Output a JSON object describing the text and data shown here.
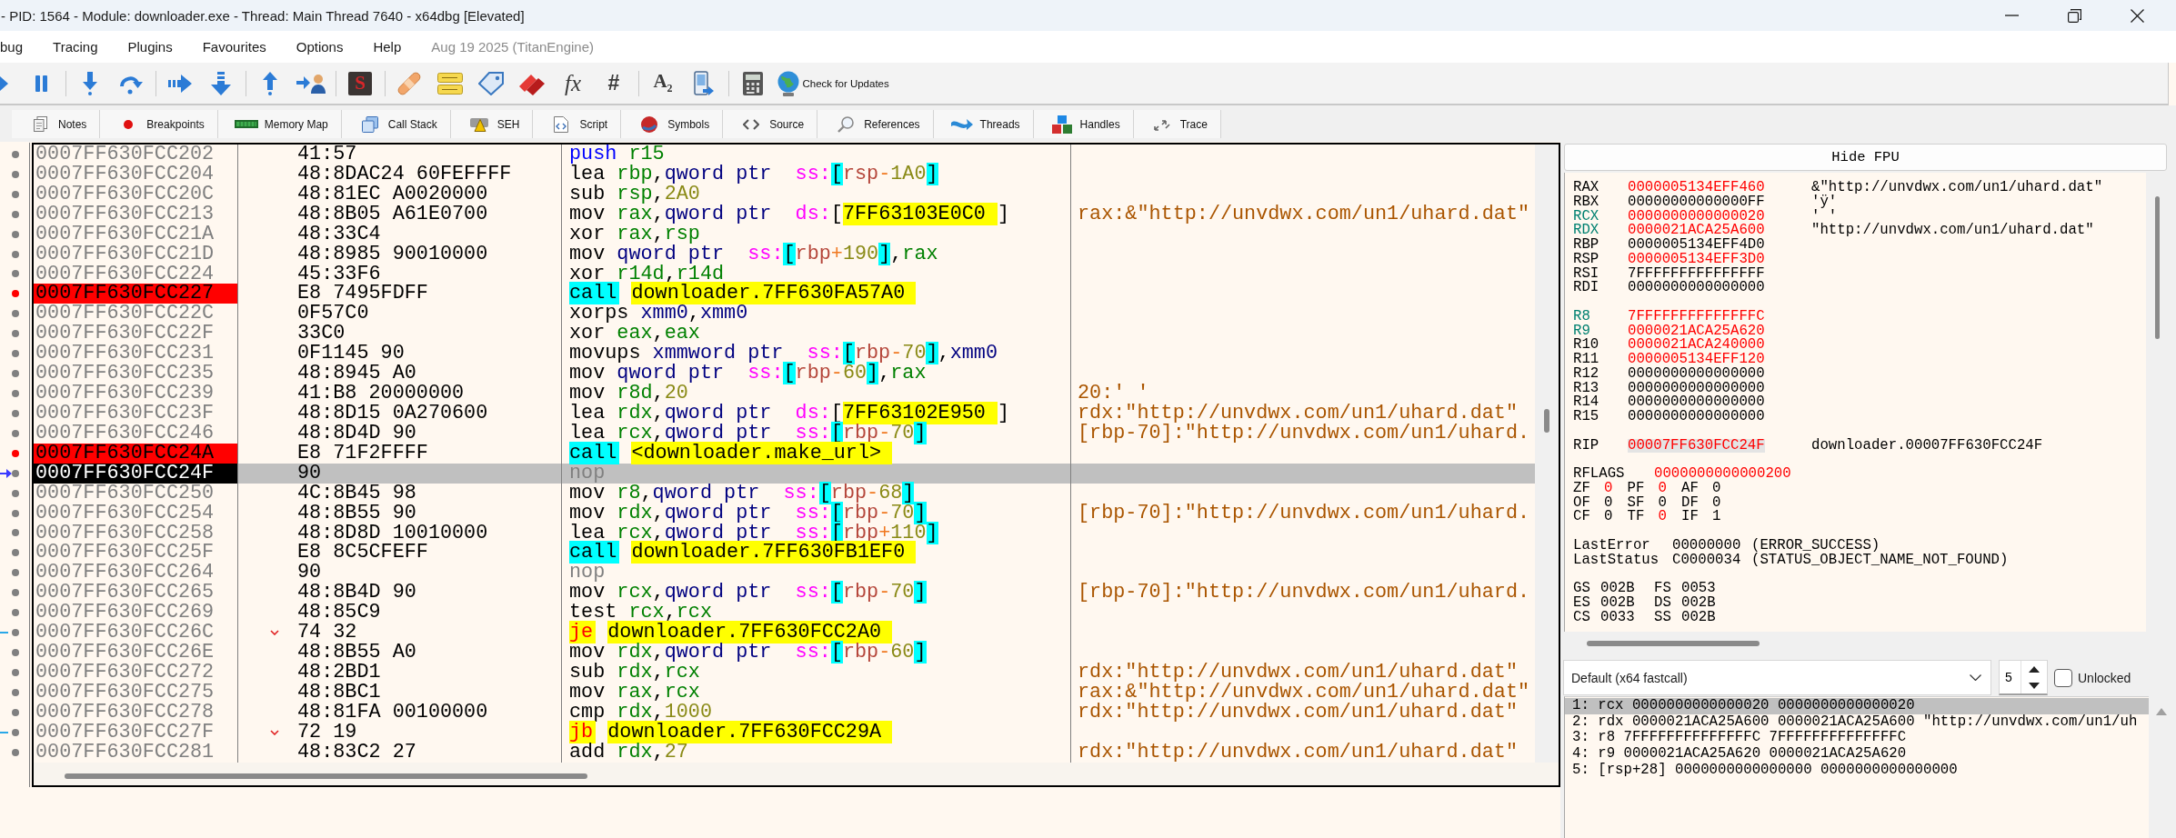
{
  "window": {
    "title": "- PID: 1564 - Module: downloader.exe - Thread: Main Thread 7640 - x64dbg [Elevated]"
  },
  "menu": {
    "items": [
      "bug",
      "Tracing",
      "Plugins",
      "Favourites",
      "Options",
      "Help"
    ],
    "build_info": "Aug 19 2025 (TitanEngine)"
  },
  "toolbar": {
    "labels": [
      "S",
      "fx",
      "#",
      "A$_{2}$"
    ],
    "update_button": "Check for Updates"
  },
  "tabs": [
    {
      "label": "Notes",
      "selected": false
    },
    {
      "label": "Breakpoints",
      "selected": false
    },
    {
      "label": "Memory Map",
      "selected": false
    },
    {
      "label": "Call Stack",
      "selected": false
    },
    {
      "label": "SEH",
      "selected": false
    },
    {
      "label": "Script",
      "selected": false
    },
    {
      "label": "Symbols",
      "selected": false
    },
    {
      "label": "Source",
      "selected": false
    },
    {
      "label": "References",
      "selected": false
    },
    {
      "label": "Threads",
      "selected": false
    },
    {
      "label": "Handles",
      "selected": false
    },
    {
      "label": "Trace",
      "selected": false
    }
  ],
  "disassembly": {
    "rows": [
      {
        "address": "0007FF630FCC202",
        "bytes": "41:57",
        "instruction": [
          {
            "text": "push ",
            "kind": "push"
          },
          {
            "text": "r15",
            "kind": "reg"
          }
        ],
        "breakpoint": false,
        "rip": false,
        "selected": false,
        "jump": false
      },
      {
        "address": "0007FF630FCC204",
        "bytes": "48:8DAC24 60FEFFFF",
        "instruction": [
          {
            "text": "lea ",
            "kind": "op"
          },
          {
            "text": "rbp",
            "kind": "reg"
          },
          {
            "text": ",",
            "kind": "plain"
          },
          {
            "text": "qword ptr  ",
            "kind": "size"
          },
          {
            "text": "ss:",
            "kind": "seg"
          },
          {
            "text": "[",
            "kind": "bracket"
          },
          {
            "text": "rsp",
            "kind": "base"
          },
          {
            "text": "-",
            "kind": "operator"
          },
          {
            "text": "1A0",
            "kind": "disp"
          },
          {
            "text": "]",
            "kind": "bracket"
          }
        ],
        "breakpoint": false,
        "rip": false,
        "selected": false,
        "jump": false
      },
      {
        "address": "0007FF630FCC20C",
        "bytes": "48:81EC A0020000",
        "instruction": [
          {
            "text": "sub ",
            "kind": "op"
          },
          {
            "text": "rsp",
            "kind": "reg"
          },
          {
            "text": ",",
            "kind": "plain"
          },
          {
            "text": "2A0",
            "kind": "imm"
          }
        ],
        "breakpoint": false,
        "rip": false,
        "selected": false,
        "jump": false
      },
      {
        "address": "0007FF630FCC213",
        "bytes": "48:8B05 A61E0700",
        "instruction": [
          {
            "text": "mov ",
            "kind": "op"
          },
          {
            "text": "rax",
            "kind": "reg"
          },
          {
            "text": ",",
            "kind": "plain"
          },
          {
            "text": "qword ptr  ",
            "kind": "size"
          },
          {
            "text": "ds:",
            "kind": "seg"
          },
          {
            "text": "[",
            "kind": "plain"
          },
          {
            "text": "7FF63103E0C0 ",
            "kind": "addr"
          },
          {
            "text": "]",
            "kind": "plain"
          }
        ],
        "comment": "rax:&\"http://unvdwx.com/un1/uhard.dat\"",
        "breakpoint": false,
        "rip": false,
        "selected": false,
        "jump": false
      },
      {
        "address": "0007FF630FCC21A",
        "bytes": "48:33C4",
        "instruction": [
          {
            "text": "xor ",
            "kind": "op"
          },
          {
            "text": "rax",
            "kind": "reg"
          },
          {
            "text": ",",
            "kind": "plain"
          },
          {
            "text": "rsp",
            "kind": "reg"
          }
        ],
        "breakpoint": false,
        "rip": false,
        "selected": false,
        "jump": false
      },
      {
        "address": "0007FF630FCC21D",
        "bytes": "48:8985 90010000",
        "instruction": [
          {
            "text": "mov ",
            "kind": "op"
          },
          {
            "text": "qword ptr  ",
            "kind": "size"
          },
          {
            "text": "ss:",
            "kind": "seg"
          },
          {
            "text": "[",
            "kind": "bracket"
          },
          {
            "text": "rbp",
            "kind": "base"
          },
          {
            "text": "+",
            "kind": "operator"
          },
          {
            "text": "190",
            "kind": "disp"
          },
          {
            "text": "]",
            "kind": "bracket"
          },
          {
            "text": ",",
            "kind": "plain"
          },
          {
            "text": "rax",
            "kind": "reg"
          }
        ],
        "breakpoint": false,
        "rip": false,
        "selected": false,
        "jump": false
      },
      {
        "address": "0007FF630FCC224",
        "bytes": "45:33F6",
        "instruction": [
          {
            "text": "xor ",
            "kind": "op"
          },
          {
            "text": "r14d",
            "kind": "reg"
          },
          {
            "text": ",",
            "kind": "plain"
          },
          {
            "text": "r14d",
            "kind": "reg"
          }
        ],
        "breakpoint": false,
        "rip": false,
        "selected": false,
        "jump": false
      },
      {
        "address": "0007FF630FCC227",
        "bytes": "E8 7495FDFF",
        "instruction": [
          {
            "text": "call ",
            "kind": "call"
          },
          {
            "text": "downloader.7FF630FA57A0",
            "kind": "target"
          }
        ],
        "breakpoint": true,
        "rip": false,
        "selected": false,
        "jump": false
      },
      {
        "address": "0007FF630FCC22C",
        "bytes": "0F57C0",
        "instruction": [
          {
            "text": "xorps ",
            "kind": "op"
          },
          {
            "text": "xmm0",
            "kind": "sse"
          },
          {
            "text": ",",
            "kind": "plain"
          },
          {
            "text": "xmm0",
            "kind": "sse"
          }
        ],
        "breakpoint": false,
        "rip": false,
        "selected": false,
        "jump": false
      },
      {
        "address": "0007FF630FCC22F",
        "bytes": "33C0",
        "instruction": [
          {
            "text": "xor ",
            "kind": "op"
          },
          {
            "text": "eax",
            "kind": "reg"
          },
          {
            "text": ",",
            "kind": "plain"
          },
          {
            "text": "eax",
            "kind": "reg"
          }
        ],
        "breakpoint": false,
        "rip": false,
        "selected": false,
        "jump": false
      },
      {
        "address": "0007FF630FCC231",
        "bytes": "0F1145 90",
        "instruction": [
          {
            "text": "movups ",
            "kind": "op"
          },
          {
            "text": "xmmword ptr  ",
            "kind": "size"
          },
          {
            "text": "ss:",
            "kind": "seg"
          },
          {
            "text": "[",
            "kind": "bracket"
          },
          {
            "text": "rbp",
            "kind": "base"
          },
          {
            "text": "-",
            "kind": "operator"
          },
          {
            "text": "70",
            "kind": "disp"
          },
          {
            "text": "]",
            "kind": "bracket"
          },
          {
            "text": ",",
            "kind": "plain"
          },
          {
            "text": "xmm0",
            "kind": "sse"
          }
        ],
        "breakpoint": false,
        "rip": false,
        "selected": false,
        "jump": false
      },
      {
        "address": "0007FF630FCC235",
        "bytes": "48:8945 A0",
        "instruction": [
          {
            "text": "mov ",
            "kind": "op"
          },
          {
            "text": "qword ptr  ",
            "kind": "size"
          },
          {
            "text": "ss:",
            "kind": "seg"
          },
          {
            "text": "[",
            "kind": "bracket"
          },
          {
            "text": "rbp",
            "kind": "base"
          },
          {
            "text": "-",
            "kind": "operator"
          },
          {
            "text": "60",
            "kind": "disp"
          },
          {
            "text": "]",
            "kind": "bracket"
          },
          {
            "text": ",",
            "kind": "plain"
          },
          {
            "text": "rax",
            "kind": "reg"
          }
        ],
        "breakpoint": false,
        "rip": false,
        "selected": false,
        "jump": false
      },
      {
        "address": "0007FF630FCC239",
        "bytes": "41:B8 20000000",
        "instruction": [
          {
            "text": "mov ",
            "kind": "op"
          },
          {
            "text": "r8d",
            "kind": "reg"
          },
          {
            "text": ",",
            "kind": "plain"
          },
          {
            "text": "20",
            "kind": "imm"
          }
        ],
        "comment": "20:' '",
        "breakpoint": false,
        "rip": false,
        "selected": false,
        "jump": false
      },
      {
        "address": "0007FF630FCC23F",
        "bytes": "48:8D15 0A270600",
        "instruction": [
          {
            "text": "lea ",
            "kind": "op"
          },
          {
            "text": "rdx",
            "kind": "reg"
          },
          {
            "text": ",",
            "kind": "plain"
          },
          {
            "text": "qword ptr  ",
            "kind": "size"
          },
          {
            "text": "ds:",
            "kind": "seg"
          },
          {
            "text": "[",
            "kind": "plain"
          },
          {
            "text": "7FF63102E950 ",
            "kind": "addr"
          },
          {
            "text": "]",
            "kind": "plain"
          }
        ],
        "comment": "rdx:\"http://unvdwx.com/un1/uhard.dat\"",
        "breakpoint": false,
        "rip": false,
        "selected": false,
        "jump": false
      },
      {
        "address": "0007FF630FCC246",
        "bytes": "48:8D4D 90",
        "instruction": [
          {
            "text": "lea ",
            "kind": "op"
          },
          {
            "text": "rcx",
            "kind": "reg"
          },
          {
            "text": ",",
            "kind": "plain"
          },
          {
            "text": "qword ptr  ",
            "kind": "size"
          },
          {
            "text": "ss:",
            "kind": "seg"
          },
          {
            "text": "[",
            "kind": "bracket"
          },
          {
            "text": "rbp",
            "kind": "base"
          },
          {
            "text": "-",
            "kind": "operator"
          },
          {
            "text": "70",
            "kind": "disp"
          },
          {
            "text": "]",
            "kind": "bracket"
          }
        ],
        "comment": "[rbp-70]:\"http://unvdwx.com/un1/uhard.",
        "breakpoint": false,
        "rip": false,
        "selected": false,
        "jump": false
      },
      {
        "address": "0007FF630FCC24A",
        "bytes": "E8 71F2FFFF",
        "instruction": [
          {
            "text": "call ",
            "kind": "call"
          },
          {
            "text": "<downloader.make_url>",
            "kind": "target"
          }
        ],
        "breakpoint": true,
        "rip": false,
        "selected": false,
        "jump": false
      },
      {
        "address": "0007FF630FCC24F",
        "bytes": "90",
        "instruction": [
          {
            "text": "nop",
            "kind": "nop"
          }
        ],
        "breakpoint": false,
        "rip": true,
        "selected": true,
        "jump": false
      },
      {
        "address": "0007FF630FCC250",
        "bytes": "4C:8B45 98",
        "instruction": [
          {
            "text": "mov ",
            "kind": "op"
          },
          {
            "text": "r8",
            "kind": "reg"
          },
          {
            "text": ",",
            "kind": "plain"
          },
          {
            "text": "qword ptr  ",
            "kind": "size"
          },
          {
            "text": "ss:",
            "kind": "seg"
          },
          {
            "text": "[",
            "kind": "bracket"
          },
          {
            "text": "rbp",
            "kind": "base"
          },
          {
            "text": "-",
            "kind": "operator"
          },
          {
            "text": "68",
            "kind": "disp"
          },
          {
            "text": "]",
            "kind": "bracket"
          }
        ],
        "breakpoint": false,
        "rip": false,
        "selected": false,
        "jump": false
      },
      {
        "address": "0007FF630FCC254",
        "bytes": "48:8B55 90",
        "instruction": [
          {
            "text": "mov ",
            "kind": "op"
          },
          {
            "text": "rdx",
            "kind": "reg"
          },
          {
            "text": ",",
            "kind": "plain"
          },
          {
            "text": "qword ptr  ",
            "kind": "size"
          },
          {
            "text": "ss:",
            "kind": "seg"
          },
          {
            "text": "[",
            "kind": "bracket"
          },
          {
            "text": "rbp",
            "kind": "base"
          },
          {
            "text": "-",
            "kind": "operator"
          },
          {
            "text": "70",
            "kind": "disp"
          },
          {
            "text": "]",
            "kind": "bracket"
          }
        ],
        "comment": "[rbp-70]:\"http://unvdwx.com/un1/uhard.",
        "breakpoint": false,
        "rip": false,
        "selected": false,
        "jump": false
      },
      {
        "address": "0007FF630FCC258",
        "bytes": "48:8D8D 10010000",
        "instruction": [
          {
            "text": "lea ",
            "kind": "op"
          },
          {
            "text": "rcx",
            "kind": "reg"
          },
          {
            "text": ",",
            "kind": "plain"
          },
          {
            "text": "qword ptr  ",
            "kind": "size"
          },
          {
            "text": "ss:",
            "kind": "seg"
          },
          {
            "text": "[",
            "kind": "bracket"
          },
          {
            "text": "rbp",
            "kind": "base"
          },
          {
            "text": "+",
            "kind": "operator"
          },
          {
            "text": "110",
            "kind": "disp"
          },
          {
            "text": "]",
            "kind": "bracket"
          }
        ],
        "breakpoint": false,
        "rip": false,
        "selected": false,
        "jump": false
      },
      {
        "address": "0007FF630FCC25F",
        "bytes": "E8 8C5CFEFF",
        "instruction": [
          {
            "text": "call ",
            "kind": "call"
          },
          {
            "text": "downloader.7FF630FB1EF0",
            "kind": "target"
          }
        ],
        "breakpoint": false,
        "rip": false,
        "selected": false,
        "jump": false
      },
      {
        "address": "0007FF630FCC264",
        "bytes": "90",
        "instruction": [
          {
            "text": "nop",
            "kind": "nop"
          }
        ],
        "breakpoint": false,
        "rip": false,
        "selected": false,
        "jump": false
      },
      {
        "address": "0007FF630FCC265",
        "bytes": "48:8B4D 90",
        "instruction": [
          {
            "text": "mov ",
            "kind": "op"
          },
          {
            "text": "rcx",
            "kind": "reg"
          },
          {
            "text": ",",
            "kind": "plain"
          },
          {
            "text": "qword ptr  ",
            "kind": "size"
          },
          {
            "text": "ss:",
            "kind": "seg"
          },
          {
            "text": "[",
            "kind": "bracket"
          },
          {
            "text": "rbp",
            "kind": "base"
          },
          {
            "text": "-",
            "kind": "operator"
          },
          {
            "text": "70",
            "kind": "disp"
          },
          {
            "text": "]",
            "kind": "bracket"
          }
        ],
        "comment": "[rbp-70]:\"http://unvdwx.com/un1/uhard.",
        "breakpoint": false,
        "rip": false,
        "selected": false,
        "jump": false
      },
      {
        "address": "0007FF630FCC269",
        "bytes": "48:85C9",
        "instruction": [
          {
            "text": "test ",
            "kind": "op"
          },
          {
            "text": "rcx",
            "kind": "reg"
          },
          {
            "text": ",",
            "kind": "plain"
          },
          {
            "text": "rcx",
            "kind": "reg"
          }
        ],
        "breakpoint": false,
        "rip": false,
        "selected": false,
        "jump": false
      },
      {
        "address": "0007FF630FCC26C",
        "bytes": "74 32",
        "instruction": [
          {
            "text": "je ",
            "kind": "jcc"
          },
          {
            "text": "downloader.7FF630FCC2A0",
            "kind": "target"
          }
        ],
        "breakpoint": false,
        "rip": false,
        "selected": false,
        "jump": true
      },
      {
        "address": "0007FF630FCC26E",
        "bytes": "48:8B55 A0",
        "instruction": [
          {
            "text": "mov ",
            "kind": "op"
          },
          {
            "text": "rdx",
            "kind": "reg"
          },
          {
            "text": ",",
            "kind": "plain"
          },
          {
            "text": "qword ptr  ",
            "kind": "size"
          },
          {
            "text": "ss:",
            "kind": "seg"
          },
          {
            "text": "[",
            "kind": "bracket"
          },
          {
            "text": "rbp",
            "kind": "base"
          },
          {
            "text": "-",
            "kind": "operator"
          },
          {
            "text": "60",
            "kind": "disp"
          },
          {
            "text": "]",
            "kind": "bracket"
          }
        ],
        "breakpoint": false,
        "rip": false,
        "selected": false,
        "jump": false
      },
      {
        "address": "0007FF630FCC272",
        "bytes": "48:2BD1",
        "instruction": [
          {
            "text": "sub ",
            "kind": "op"
          },
          {
            "text": "rdx",
            "kind": "reg"
          },
          {
            "text": ",",
            "kind": "plain"
          },
          {
            "text": "rcx",
            "kind": "reg"
          }
        ],
        "comment": "rdx:\"http://unvdwx.com/un1/uhard.dat\"",
        "breakpoint": false,
        "rip": false,
        "selected": false,
        "jump": false
      },
      {
        "address": "0007FF630FCC275",
        "bytes": "48:8BC1",
        "instruction": [
          {
            "text": "mov ",
            "kind": "op"
          },
          {
            "text": "rax",
            "kind": "reg"
          },
          {
            "text": ",",
            "kind": "plain"
          },
          {
            "text": "rcx",
            "kind": "reg"
          }
        ],
        "comment": "rax:&\"http://unvdwx.com/un1/uhard.dat\"",
        "breakpoint": false,
        "rip": false,
        "selected": false,
        "jump": false
      },
      {
        "address": "0007FF630FCC278",
        "bytes": "48:81FA 00100000",
        "instruction": [
          {
            "text": "cmp ",
            "kind": "op"
          },
          {
            "text": "rdx",
            "kind": "reg"
          },
          {
            "text": ",",
            "kind": "plain"
          },
          {
            "text": "1000",
            "kind": "imm"
          }
        ],
        "comment": "rdx:\"http://unvdwx.com/un1/uhard.dat\"",
        "breakpoint": false,
        "rip": false,
        "selected": false,
        "jump": false
      },
      {
        "address": "0007FF630FCC27F",
        "bytes": "72 19",
        "instruction": [
          {
            "text": "jb ",
            "kind": "jcc"
          },
          {
            "text": "downloader.7FF630FCC29A",
            "kind": "target"
          }
        ],
        "breakpoint": false,
        "rip": false,
        "selected": false,
        "jump": true
      },
      {
        "address": "0007FF630FCC281",
        "bytes": "48:83C2 27",
        "instruction": [
          {
            "text": "add ",
            "kind": "op"
          },
          {
            "text": "rdx",
            "kind": "reg"
          },
          {
            "text": ",",
            "kind": "plain"
          },
          {
            "text": "27",
            "kind": "imm"
          }
        ],
        "comment": "rdx:\"http://unvdwx.com/un1/uhard.dat\"",
        "breakpoint": false,
        "rip": false,
        "selected": false,
        "jump": false
      }
    ]
  },
  "register_panel": {
    "fpu_button": "Hide FPU",
    "general": [
      {
        "name": "RAX",
        "value": "0000005134EFF460",
        "comment": "&\"http://unvdwx.com/un1/uhard.dat\"",
        "changed": true,
        "argument": false,
        "selected": false
      },
      {
        "name": "RBX",
        "value": "00000000000000FF",
        "comment": "'ÿ'",
        "changed": false,
        "argument": false,
        "selected": false
      },
      {
        "name": "RCX",
        "value": "0000000000000020",
        "comment": "' '",
        "changed": true,
        "argument": true,
        "selected": false
      },
      {
        "name": "RDX",
        "value": "0000021ACA25A600",
        "comment": "\"http://unvdwx.com/un1/uhard.dat\"",
        "changed": true,
        "argument": true,
        "selected": false
      },
      {
        "name": "RBP",
        "value": "0000005134EFF4D0",
        "changed": false,
        "argument": false,
        "selected": false
      },
      {
        "name": "RSP",
        "value": "0000005134EFF3D0",
        "changed": true,
        "argument": false,
        "selected": false
      },
      {
        "name": "RSI",
        "value": "7FFFFFFFFFFFFFFF",
        "changed": false,
        "argument": false,
        "selected": false
      },
      {
        "name": "RDI",
        "value": "0000000000000000",
        "changed": false,
        "argument": false,
        "selected": false
      }
    ],
    "extended": [
      {
        "name": "R8",
        "value": "7FFFFFFFFFFFFFFC",
        "changed": true,
        "argument": true,
        "selected": false
      },
      {
        "name": "R9",
        "value": "0000021ACA25A620",
        "changed": true,
        "argument": true,
        "selected": false
      },
      {
        "name": "R10",
        "value": "0000021ACA240000",
        "changed": true,
        "argument": false,
        "selected": false
      },
      {
        "name": "R11",
        "value": "0000005134EFF120",
        "changed": true,
        "argument": false,
        "selected": false
      },
      {
        "name": "R12",
        "value": "0000000000000000",
        "changed": false,
        "argument": false,
        "selected": false
      },
      {
        "name": "R13",
        "value": "0000000000000000",
        "changed": false,
        "argument": false,
        "selected": false
      },
      {
        "name": "R14",
        "value": "0000000000000000",
        "changed": false,
        "argument": false,
        "selected": false
      },
      {
        "name": "R15",
        "value": "0000000000000000",
        "changed": false,
        "argument": false,
        "selected": false
      }
    ],
    "rip": {
      "name": "RIP",
      "value": "00007FF630FCC24F",
      "comment": "downloader.00007FF630FCC24F",
      "changed": true,
      "selected": true
    },
    "rflags": {
      "name": "RFLAGS",
      "value": "0000000000000200",
      "changed": true
    },
    "flags": [
      {
        "name": "ZF",
        "value": "0",
        "changed": true
      },
      {
        "name": "PF",
        "value": "0",
        "changed": true
      },
      {
        "name": "AF",
        "value": "0",
        "changed": false
      },
      {
        "name": "OF",
        "value": "0",
        "changed": false
      },
      {
        "name": "SF",
        "value": "0",
        "changed": false
      },
      {
        "name": "DF",
        "value": "0",
        "changed": false
      },
      {
        "name": "CF",
        "value": "0",
        "changed": false
      },
      {
        "name": "TF",
        "value": "0",
        "changed": true
      },
      {
        "name": "IF",
        "value": "1",
        "changed": false
      }
    ],
    "last_error": {
      "label": "LastError",
      "code": "00000000",
      "text": "(ERROR_SUCCESS)"
    },
    "last_status": {
      "label": "LastStatus",
      "code": "C0000034",
      "text": "(STATUS_OBJECT_NAME_NOT_FOUND)"
    },
    "segments": [
      {
        "name": "GS",
        "value": "002B"
      },
      {
        "name": "FS",
        "value": "0053"
      },
      {
        "name": "ES",
        "value": "002B"
      },
      {
        "name": "DS",
        "value": "002B"
      },
      {
        "name": "CS",
        "value": "0033"
      },
      {
        "name": "SS",
        "value": "002B"
      }
    ]
  },
  "call_arguments": {
    "convention": "Default (x64 fastcall)",
    "count": "5",
    "unlocked": {
      "label": "Unlocked",
      "checked": false
    },
    "rows": [
      {
        "text": "1: rcx 0000000000000020 0000000000000020",
        "selected": true
      },
      {
        "text": "2: rdx 0000021ACA25A600 0000021ACA25A600 \"http://unvdwx.com/un1/uh",
        "selected": false
      },
      {
        "text": "3: r8 7FFFFFFFFFFFFFFC 7FFFFFFFFFFFFFFC",
        "selected": false
      },
      {
        "text": "4: r9 0000021ACA25A620 0000021ACA25A620",
        "selected": false
      },
      {
        "text": "5: [rsp+28] 0000000000000000 0000000000000000",
        "selected": false
      }
    ]
  }
}
